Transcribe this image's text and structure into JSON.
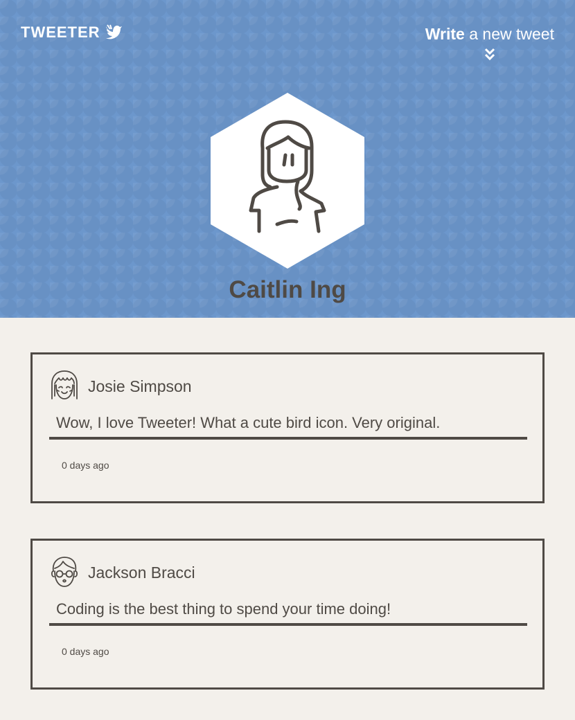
{
  "header": {
    "logo_text": "TWEETER",
    "compose_bold": "Write",
    "compose_rest": " a new tweet",
    "user_name": "Caitlin Ing",
    "colors": {
      "banner": "#6c97cc",
      "text_dark": "#4f4a45",
      "page_bg": "#f3f0eb"
    }
  },
  "icons": {
    "logo": "bird-icon",
    "compose": "double-chevron-down-icon",
    "profile": "avatar-woman-long-hair",
    "tweet_avatars": [
      "avatar-girl-bangs",
      "avatar-boy-glasses"
    ]
  },
  "tweets": [
    {
      "author": "Josie Simpson",
      "text": "Wow, I love Tweeter! What a cute bird icon. Very original.",
      "time": "0 days ago"
    },
    {
      "author": "Jackson Bracci",
      "text": "Coding is the best thing to spend your time doing!",
      "time": "0 days ago"
    }
  ]
}
